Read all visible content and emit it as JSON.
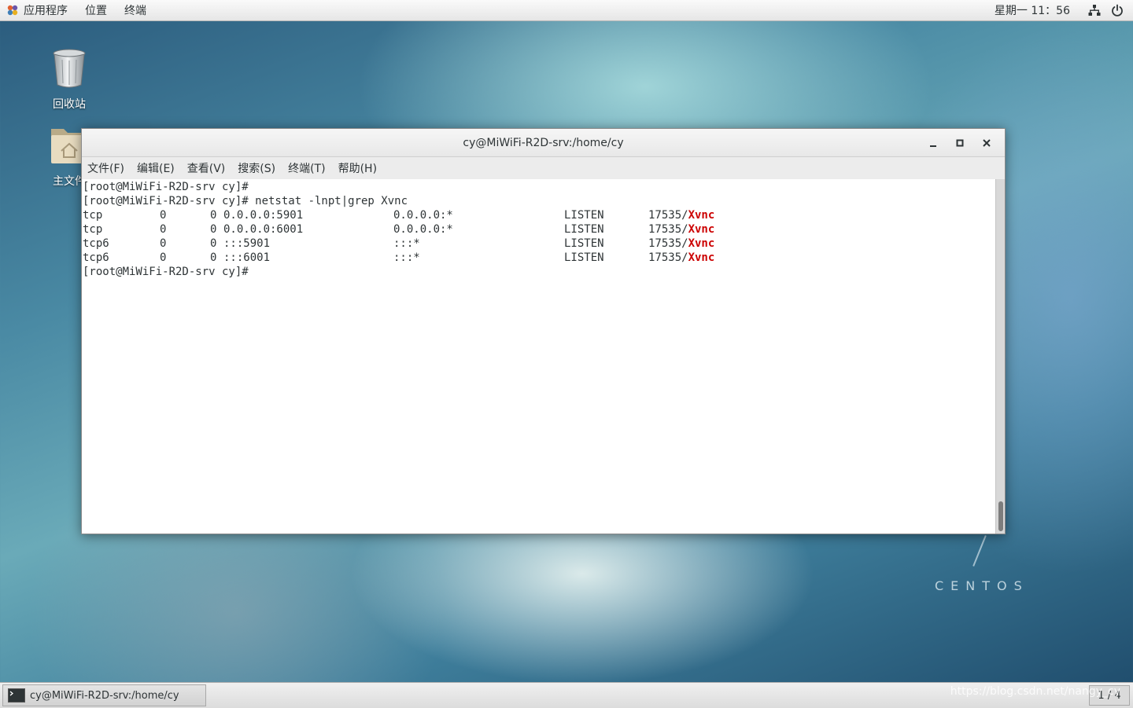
{
  "top_panel": {
    "applications_label": "应用程序",
    "places_label": "位置",
    "terminal_label": "终端",
    "clock": "星期一 11：56"
  },
  "desktop": {
    "trash_label": "回收站",
    "home_label": "主文件"
  },
  "watermark_logo": "CENTOS",
  "window": {
    "title": "cy@MiWiFi-R2D-srv:/home/cy",
    "menu": [
      "文件(F)",
      "编辑(E)",
      "查看(V)",
      "搜索(S)",
      "终端(T)",
      "帮助(H)"
    ]
  },
  "terminal": {
    "prompt1": "[root@MiWiFi-R2D-srv cy]# ",
    "prompt2": "[root@MiWiFi-R2D-srv cy]# netstat -lnpt|grep Xvnc",
    "rows": [
      {
        "proto": "tcp",
        "recvq": "0",
        "sendq": "0",
        "local": "0.0.0.0:5901",
        "foreign": "0.0.0.0:*",
        "state": "LISTEN",
        "pid": "17535/",
        "prog": "Xvnc"
      },
      {
        "proto": "tcp",
        "recvq": "0",
        "sendq": "0",
        "local": "0.0.0.0:6001",
        "foreign": "0.0.0.0:*",
        "state": "LISTEN",
        "pid": "17535/",
        "prog": "Xvnc"
      },
      {
        "proto": "tcp6",
        "recvq": "0",
        "sendq": "0",
        "local": ":::5901",
        "foreign": ":::*",
        "state": "LISTEN",
        "pid": "17535/",
        "prog": "Xvnc"
      },
      {
        "proto": "tcp6",
        "recvq": "0",
        "sendq": "0",
        "local": ":::6001",
        "foreign": ":::*",
        "state": "LISTEN",
        "pid": "17535/",
        "prog": "Xvnc"
      }
    ],
    "prompt3": "[root@MiWiFi-R2D-srv cy]# "
  },
  "taskbar": {
    "task_label": "cy@MiWiFi-R2D-srv:/home/cy",
    "workspace": "1 / 4"
  },
  "page_watermark": "https://blog.csdn.net/nangy_cy"
}
